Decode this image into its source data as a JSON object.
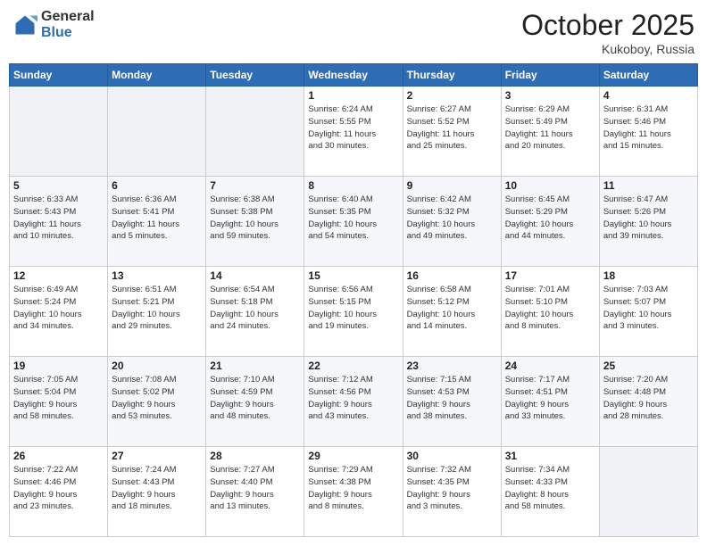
{
  "logo": {
    "general": "General",
    "blue": "Blue"
  },
  "header": {
    "month": "October 2025",
    "location": "Kukoboy, Russia"
  },
  "weekdays": [
    "Sunday",
    "Monday",
    "Tuesday",
    "Wednesday",
    "Thursday",
    "Friday",
    "Saturday"
  ],
  "weeks": [
    [
      {
        "day": "",
        "info": ""
      },
      {
        "day": "",
        "info": ""
      },
      {
        "day": "",
        "info": ""
      },
      {
        "day": "1",
        "info": "Sunrise: 6:24 AM\nSunset: 5:55 PM\nDaylight: 11 hours\nand 30 minutes."
      },
      {
        "day": "2",
        "info": "Sunrise: 6:27 AM\nSunset: 5:52 PM\nDaylight: 11 hours\nand 25 minutes."
      },
      {
        "day": "3",
        "info": "Sunrise: 6:29 AM\nSunset: 5:49 PM\nDaylight: 11 hours\nand 20 minutes."
      },
      {
        "day": "4",
        "info": "Sunrise: 6:31 AM\nSunset: 5:46 PM\nDaylight: 11 hours\nand 15 minutes."
      }
    ],
    [
      {
        "day": "5",
        "info": "Sunrise: 6:33 AM\nSunset: 5:43 PM\nDaylight: 11 hours\nand 10 minutes."
      },
      {
        "day": "6",
        "info": "Sunrise: 6:36 AM\nSunset: 5:41 PM\nDaylight: 11 hours\nand 5 minutes."
      },
      {
        "day": "7",
        "info": "Sunrise: 6:38 AM\nSunset: 5:38 PM\nDaylight: 10 hours\nand 59 minutes."
      },
      {
        "day": "8",
        "info": "Sunrise: 6:40 AM\nSunset: 5:35 PM\nDaylight: 10 hours\nand 54 minutes."
      },
      {
        "day": "9",
        "info": "Sunrise: 6:42 AM\nSunset: 5:32 PM\nDaylight: 10 hours\nand 49 minutes."
      },
      {
        "day": "10",
        "info": "Sunrise: 6:45 AM\nSunset: 5:29 PM\nDaylight: 10 hours\nand 44 minutes."
      },
      {
        "day": "11",
        "info": "Sunrise: 6:47 AM\nSunset: 5:26 PM\nDaylight: 10 hours\nand 39 minutes."
      }
    ],
    [
      {
        "day": "12",
        "info": "Sunrise: 6:49 AM\nSunset: 5:24 PM\nDaylight: 10 hours\nand 34 minutes."
      },
      {
        "day": "13",
        "info": "Sunrise: 6:51 AM\nSunset: 5:21 PM\nDaylight: 10 hours\nand 29 minutes."
      },
      {
        "day": "14",
        "info": "Sunrise: 6:54 AM\nSunset: 5:18 PM\nDaylight: 10 hours\nand 24 minutes."
      },
      {
        "day": "15",
        "info": "Sunrise: 6:56 AM\nSunset: 5:15 PM\nDaylight: 10 hours\nand 19 minutes."
      },
      {
        "day": "16",
        "info": "Sunrise: 6:58 AM\nSunset: 5:12 PM\nDaylight: 10 hours\nand 14 minutes."
      },
      {
        "day": "17",
        "info": "Sunrise: 7:01 AM\nSunset: 5:10 PM\nDaylight: 10 hours\nand 8 minutes."
      },
      {
        "day": "18",
        "info": "Sunrise: 7:03 AM\nSunset: 5:07 PM\nDaylight: 10 hours\nand 3 minutes."
      }
    ],
    [
      {
        "day": "19",
        "info": "Sunrise: 7:05 AM\nSunset: 5:04 PM\nDaylight: 9 hours\nand 58 minutes."
      },
      {
        "day": "20",
        "info": "Sunrise: 7:08 AM\nSunset: 5:02 PM\nDaylight: 9 hours\nand 53 minutes."
      },
      {
        "day": "21",
        "info": "Sunrise: 7:10 AM\nSunset: 4:59 PM\nDaylight: 9 hours\nand 48 minutes."
      },
      {
        "day": "22",
        "info": "Sunrise: 7:12 AM\nSunset: 4:56 PM\nDaylight: 9 hours\nand 43 minutes."
      },
      {
        "day": "23",
        "info": "Sunrise: 7:15 AM\nSunset: 4:53 PM\nDaylight: 9 hours\nand 38 minutes."
      },
      {
        "day": "24",
        "info": "Sunrise: 7:17 AM\nSunset: 4:51 PM\nDaylight: 9 hours\nand 33 minutes."
      },
      {
        "day": "25",
        "info": "Sunrise: 7:20 AM\nSunset: 4:48 PM\nDaylight: 9 hours\nand 28 minutes."
      }
    ],
    [
      {
        "day": "26",
        "info": "Sunrise: 7:22 AM\nSunset: 4:46 PM\nDaylight: 9 hours\nand 23 minutes."
      },
      {
        "day": "27",
        "info": "Sunrise: 7:24 AM\nSunset: 4:43 PM\nDaylight: 9 hours\nand 18 minutes."
      },
      {
        "day": "28",
        "info": "Sunrise: 7:27 AM\nSunset: 4:40 PM\nDaylight: 9 hours\nand 13 minutes."
      },
      {
        "day": "29",
        "info": "Sunrise: 7:29 AM\nSunset: 4:38 PM\nDaylight: 9 hours\nand 8 minutes."
      },
      {
        "day": "30",
        "info": "Sunrise: 7:32 AM\nSunset: 4:35 PM\nDaylight: 9 hours\nand 3 minutes."
      },
      {
        "day": "31",
        "info": "Sunrise: 7:34 AM\nSunset: 4:33 PM\nDaylight: 8 hours\nand 58 minutes."
      },
      {
        "day": "",
        "info": ""
      }
    ]
  ]
}
